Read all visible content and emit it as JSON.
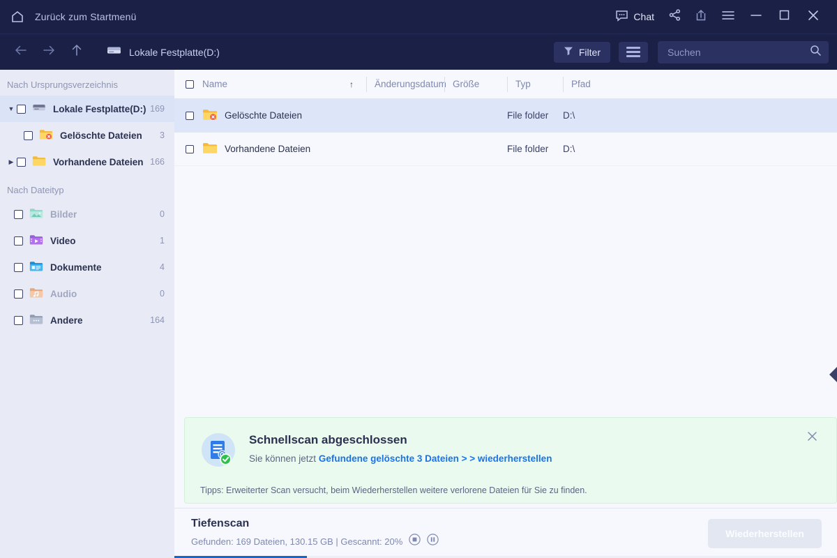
{
  "titlebar": {
    "home_label": "Zurück zum Startmenü",
    "home_icon": "home-icon",
    "chat_label": "Chat",
    "chat_icon": "chat-bubble-icon",
    "share_icon": "share-icon",
    "export_icon": "upload-icon",
    "menu_icon": "hamburger-menu-icon",
    "minimize_icon": "minimize-icon",
    "maximize_icon": "maximize-icon",
    "close_icon": "close-icon"
  },
  "navbar": {
    "back_icon": "arrow-left-icon",
    "forward_icon": "arrow-right-icon",
    "up_icon": "arrow-up-icon",
    "drive_icon": "hard-drive-icon",
    "breadcrumb": "Lokale Festplatte(D:)",
    "filter_label": "Filter",
    "filter_icon": "funnel-icon",
    "view_icon": "list-view-icon",
    "search_placeholder": "Suchen",
    "search_value": "",
    "search_icon": "search-icon"
  },
  "sidebar": {
    "section_origin": "Nach Ursprungsverzeichnis",
    "section_filetype": "Nach Dateityp",
    "origin_items": [
      {
        "label": "Lokale Festplatte(D:)",
        "count": "169",
        "icon": "hard-drive-icon",
        "caret": "expanded",
        "selected": true,
        "indent": 0,
        "dim": false
      },
      {
        "label": "Gelöschte Dateien",
        "count": "3",
        "icon": "folder-deleted-icon",
        "caret": "none",
        "selected": false,
        "indent": 1,
        "dim": false
      },
      {
        "label": "Vorhandene Dateien",
        "count": "166",
        "icon": "folder-icon",
        "caret": "collapsed",
        "selected": false,
        "indent": 1,
        "dim": false
      }
    ],
    "filetype_items": [
      {
        "label": "Bilder",
        "count": "0",
        "icon": "image-folder-icon",
        "dim": true
      },
      {
        "label": "Video",
        "count": "1",
        "icon": "video-folder-icon",
        "dim": false
      },
      {
        "label": "Dokumente",
        "count": "4",
        "icon": "document-folder-icon",
        "dim": false
      },
      {
        "label": "Audio",
        "count": "0",
        "icon": "audio-folder-icon",
        "dim": true
      },
      {
        "label": "Andere",
        "count": "164",
        "icon": "other-folder-icon",
        "dim": false
      }
    ]
  },
  "table": {
    "columns": {
      "name": "Name",
      "date": "Änderungsdatum",
      "size": "Größe",
      "type": "Typ",
      "path": "Pfad"
    },
    "sort_indicator": "↑",
    "rows": [
      {
        "name": "Gelöschte Dateien",
        "date": "",
        "size": "",
        "type": "File folder",
        "path": "D:\\",
        "icon": "folder-deleted-icon",
        "selected": true
      },
      {
        "name": "Vorhandene Dateien",
        "date": "",
        "size": "",
        "type": "File folder",
        "path": "D:\\",
        "icon": "folder-icon",
        "selected": false
      }
    ]
  },
  "panel_handle_icon": "collapse-panel-left-icon",
  "notification": {
    "icon": "scan-complete-icon",
    "title": "Schnellscan abgeschlossen",
    "subtitle_prefix": "Sie können jetzt ",
    "link_text": "Gefundene gelöschte 3 Dateien > > wiederherstellen",
    "tip": "Tipps: Erweiterter Scan versucht, beim Wiederherstellen weitere verlorene Dateien für Sie zu finden.",
    "close_icon": "close-icon",
    "bg_color": "#eafaee"
  },
  "footer": {
    "scan_title": "Tiefenscan",
    "scan_stats": "Gefunden: 169 Dateien, 130.15 GB | Gescannt: 20%",
    "stop_icon": "stop-icon",
    "pause_icon": "pause-icon",
    "recover_label": "Wiederherstellen",
    "progress_percent": 20,
    "progress_color": "#1765cc"
  }
}
